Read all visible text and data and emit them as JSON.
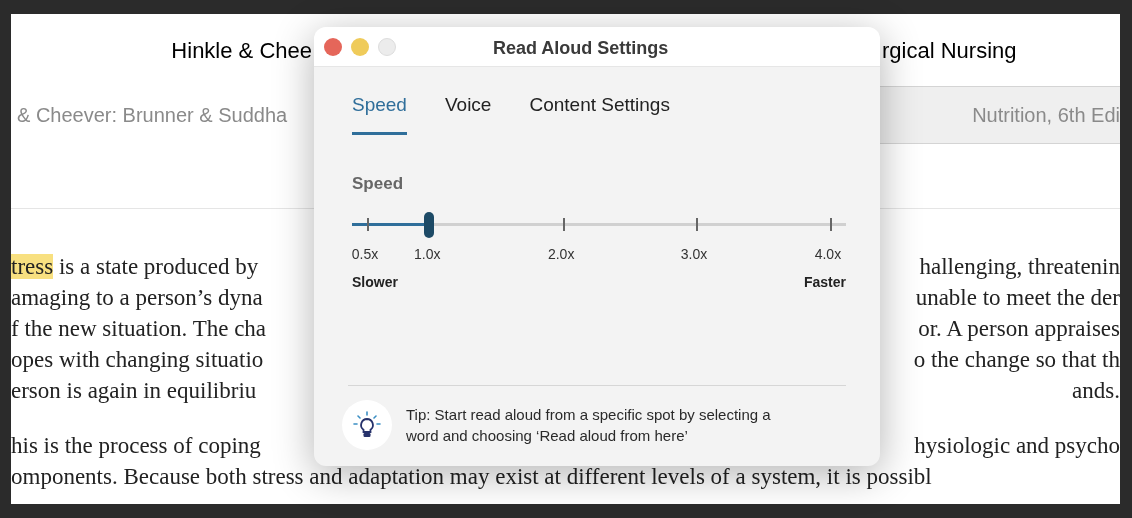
{
  "book": {
    "title_left": "Hinkle & Chee",
    "title_right": "rgical Nursing",
    "tabs": [
      {
        "label": "& Cheever: Brunner & Suddha",
        "selected": true
      },
      {
        "label": "Nutrition, 6th Edi",
        "selected": false
      }
    ],
    "paragraphs": [
      [
        {
          "left": "**tress** is a state produced by",
          "right": "hallenging, threatenin"
        },
        {
          "left": "amaging to a person’s dyna",
          "right": "unable to meet the der"
        },
        {
          "left": "f the new situation. The cha",
          "right": "or. A person appraises"
        },
        {
          "left": "opes with changing situatio",
          "right": "o the change so that th"
        },
        {
          "left": "erson is again in equilibriu",
          "right": "ands."
        }
      ],
      [
        {
          "left": "his is the process of coping",
          "right": "hysiologic and psycho"
        },
        {
          "full": "omponents. Because both stress and adaptation may exist at different levels of a system, it is possibl"
        }
      ]
    ]
  },
  "dialog": {
    "title": "Read Aloud Settings",
    "tabs": [
      {
        "label": "Speed",
        "selected": true
      },
      {
        "label": "Voice",
        "selected": false
      },
      {
        "label": "Content Settings",
        "selected": false
      }
    ],
    "speed": {
      "label": "Speed",
      "level": 0.156,
      "ticks": [
        "0.5x",
        "1.0x",
        "2.0x",
        "3.0x",
        "4.0x"
      ],
      "min_label": "Slower",
      "max_label": "Faster"
    },
    "tip": "Tip: Start read aloud from a specific spot by selecting a word and choosing ‘Read aloud from here’"
  }
}
